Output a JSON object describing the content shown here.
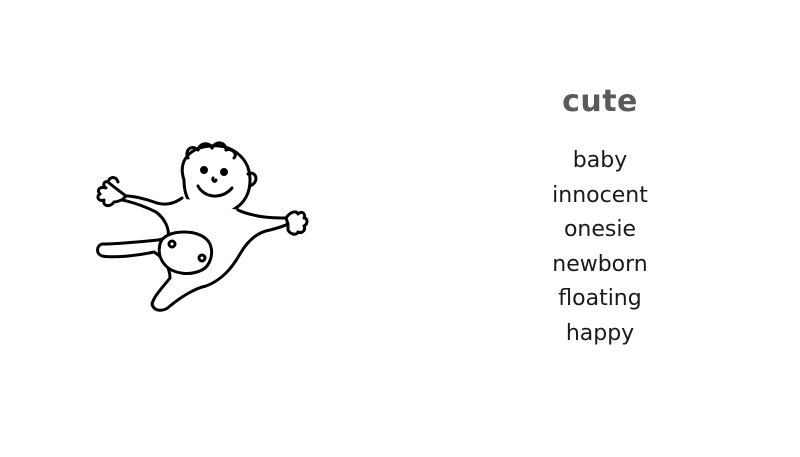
{
  "illustration": {
    "icon": "baby-onesie-icon"
  },
  "heading": "cute",
  "words": [
    "baby",
    "innocent",
    "onesie",
    "newborn",
    "floating",
    "happy"
  ],
  "colors": {
    "background": "#ffffff",
    "heading": "#5a5a5a",
    "text": "#1a1a1a",
    "line_art": "#000000"
  }
}
